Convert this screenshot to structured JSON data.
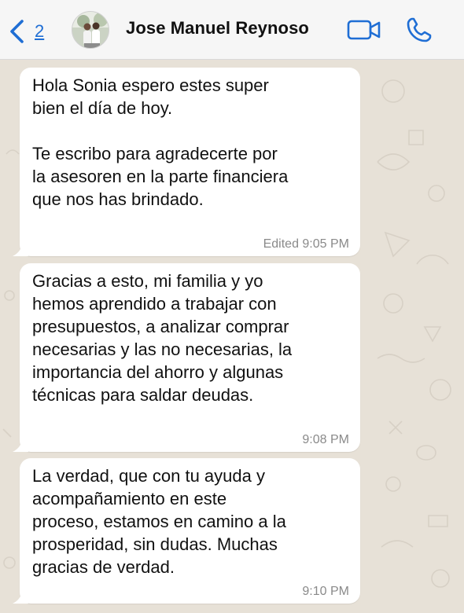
{
  "header": {
    "back_count": "2",
    "contact_name": "Jose Manuel Reynoso"
  },
  "messages": [
    {
      "text": "Hola Sonia espero estes super\nbien el día de hoy.\n\nTe escribo para agradecerte por\nla asesoren en la parte financiera\nque nos has brindado.",
      "meta": "Edited 9:05 PM"
    },
    {
      "text": "Gracias a esto, mi familia y yo\nhemos aprendido a trabajar con\npresupuestos, a analizar comprar\nnecesarias y las no necesarias, la\nimportancia del ahorro y algunas\ntécnicas para saldar deudas.",
      "meta": "9:08 PM"
    },
    {
      "text": "La verdad, que con tu ayuda y\nacompañamiento en este\nproceso, estamos en camino a la\nprosperidad, sin dudas. Muchas\ngracias de verdad.",
      "meta": "9:10 PM"
    }
  ],
  "colors": {
    "accent": "#1f6ed4",
    "chat_background": "#e7e1d7",
    "bubble": "#ffffff",
    "timestamp": "#8a8a8a"
  },
  "icons": {
    "back": "chevron-left-icon",
    "video": "video-camera-icon",
    "call": "phone-icon"
  }
}
